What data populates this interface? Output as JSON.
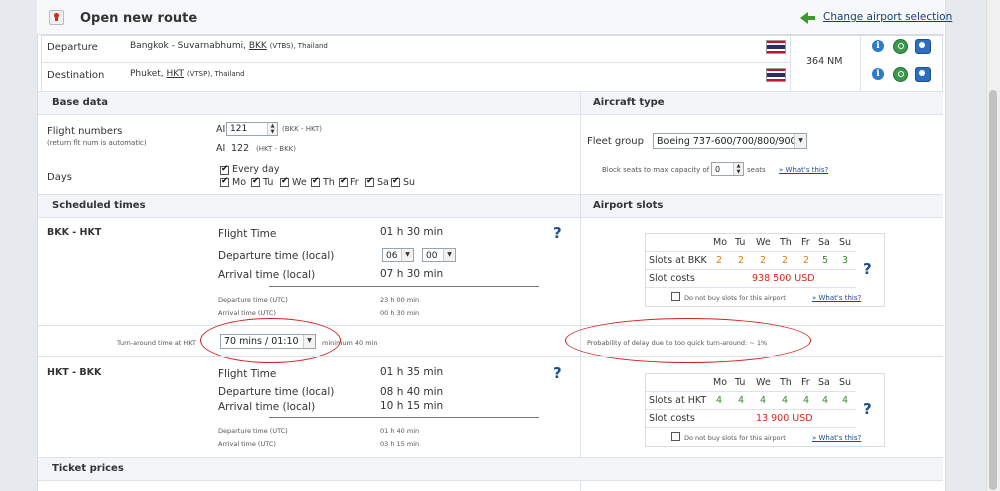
{
  "header": {
    "title": "Open new route",
    "change_link": "Change airport selection"
  },
  "route": {
    "departure_label": "Departure",
    "departure_city": "Bangkok - Suvarnabhumi,",
    "departure_code": "BKK",
    "departure_icao": "(VTBS), Thailand",
    "destination_label": "Destination",
    "destination_city": "Phuket,",
    "destination_code": "HKT",
    "destination_icao": "(VTSP), Thailand",
    "distance": "364 NM"
  },
  "base": {
    "title": "Base data",
    "flight_numbers_label": "Flight numbers",
    "flight_numbers_note": "(return flt num is automatic)",
    "airline_code": "AI",
    "flight_number": "121",
    "flight_route": "(BKK - HKT)",
    "return_code": "AI",
    "return_number": "122",
    "return_route": "(HKT - BKK)",
    "days_label": "Days",
    "every_day": "Every day",
    "days": [
      "Mo",
      "Tu",
      "We",
      "Th",
      "Fr",
      "Sa",
      "Su"
    ]
  },
  "aircraft": {
    "title": "Aircraft type",
    "fleet_label": "Fleet group",
    "fleet_value": "Boeing 737-600/700/800/900",
    "block_label": "Block seats to max capacity of",
    "block_value": "0",
    "block_unit": "seats",
    "whats_this": "» What's this?"
  },
  "sched": {
    "title": "Scheduled times",
    "out_route": "BKK - HKT",
    "flight_time_label": "Flight Time",
    "out_flight_time": "01 h 30 min",
    "dep_local_label": "Departure time (local)",
    "dep_hour": "06",
    "dep_min": "00",
    "arr_local_label": "Arrival time (local)",
    "out_arr_local": "07 h 30 min",
    "dep_utc_label": "Departure time (UTC)",
    "out_dep_utc": "23 h 00 min",
    "arr_utc_label": "Arrival time (UTC)",
    "out_arr_utc": "00 h 30 min",
    "turn_label": "Turn-around time at HKT",
    "turn_value": "70 mins / 01:10",
    "turn_min": "minimum 40 min",
    "delay_note": "Probability of delay due to too quick turn-around: ~ 1%",
    "ret_route": "HKT - BKK",
    "ret_flight_time": "01 h 35 min",
    "ret_dep_local": "08 h 40 min",
    "ret_arr_local": "10 h 15 min",
    "ret_dep_utc": "01 h 40 min",
    "ret_arr_utc": "03 h 15 min"
  },
  "slots": {
    "title": "Airport slots",
    "days": [
      "Mo",
      "Tu",
      "We",
      "Th",
      "Fr",
      "Sa",
      "Su"
    ],
    "bkk_label": "Slots at BKK",
    "bkk_values": [
      "2",
      "2",
      "2",
      "2",
      "2",
      "5",
      "3"
    ],
    "bkk_cost_label": "Slot costs",
    "bkk_cost": "938 500 USD",
    "hkt_label": "Slots at HKT",
    "hkt_values": [
      "4",
      "4",
      "4",
      "4",
      "4",
      "4",
      "4"
    ],
    "hkt_cost_label": "Slot costs",
    "hkt_cost": "13 900 USD",
    "no_buy": "Do not buy slots for this airport",
    "whats_this": "» What's this?"
  },
  "ticket": {
    "title": "Ticket prices"
  }
}
